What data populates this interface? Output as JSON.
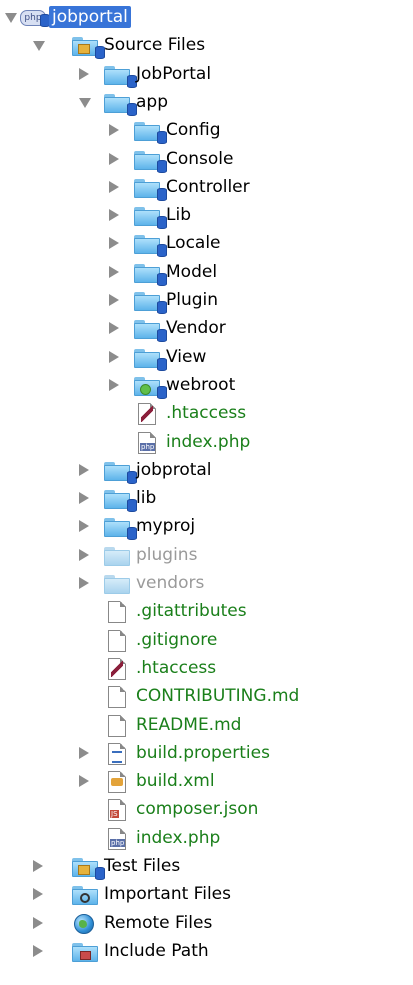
{
  "tree": [
    {
      "label": "jobportal",
      "icon": "php-project-icon",
      "twisty": "expanded",
      "level": 0,
      "style": "selected",
      "interactable": true
    },
    {
      "label": "Source Files",
      "icon": "source-folder-icon",
      "twisty": "expanded",
      "level": 1,
      "style": "normal"
    },
    {
      "label": "JobPortal",
      "icon": "folder-icon",
      "twisty": "collapsed",
      "level": 2,
      "style": "normal"
    },
    {
      "label": "app",
      "icon": "folder-icon",
      "twisty": "expanded",
      "level": 2,
      "style": "normal"
    },
    {
      "label": "Config",
      "icon": "folder-icon",
      "twisty": "collapsed",
      "level": 3,
      "style": "normal"
    },
    {
      "label": "Console",
      "icon": "folder-icon",
      "twisty": "collapsed",
      "level": 3,
      "style": "normal"
    },
    {
      "label": "Controller",
      "icon": "folder-icon",
      "twisty": "collapsed",
      "level": 3,
      "style": "normal"
    },
    {
      "label": "Lib",
      "icon": "folder-icon",
      "twisty": "collapsed",
      "level": 3,
      "style": "normal"
    },
    {
      "label": "Locale",
      "icon": "folder-icon",
      "twisty": "collapsed",
      "level": 3,
      "style": "normal"
    },
    {
      "label": "Model",
      "icon": "folder-icon",
      "twisty": "collapsed",
      "level": 3,
      "style": "normal"
    },
    {
      "label": "Plugin",
      "icon": "folder-icon",
      "twisty": "collapsed",
      "level": 3,
      "style": "normal"
    },
    {
      "label": "Vendor",
      "icon": "folder-icon",
      "twisty": "collapsed",
      "level": 3,
      "style": "normal"
    },
    {
      "label": "View",
      "icon": "folder-icon",
      "twisty": "collapsed",
      "level": 3,
      "style": "normal"
    },
    {
      "label": "webroot",
      "icon": "web-folder-icon",
      "twisty": "collapsed",
      "level": 3,
      "style": "normal"
    },
    {
      "label": ".htaccess",
      "icon": "htaccess-file-icon",
      "twisty": "none",
      "level": 3,
      "style": "green"
    },
    {
      "label": "index.php",
      "icon": "php-file-icon",
      "twisty": "none",
      "level": 3,
      "style": "green"
    },
    {
      "label": "jobprotal",
      "icon": "folder-icon",
      "twisty": "collapsed",
      "level": 2,
      "style": "normal"
    },
    {
      "label": "lib",
      "icon": "folder-icon",
      "twisty": "collapsed",
      "level": 2,
      "style": "normal"
    },
    {
      "label": "myproj",
      "icon": "folder-icon",
      "twisty": "collapsed",
      "level": 2,
      "style": "normal"
    },
    {
      "label": "plugins",
      "icon": "ignored-folder-icon",
      "twisty": "collapsed",
      "level": 2,
      "style": "gray"
    },
    {
      "label": "vendors",
      "icon": "ignored-folder-icon",
      "twisty": "collapsed",
      "level": 2,
      "style": "gray"
    },
    {
      "label": ".gitattributes",
      "icon": "text-file-icon",
      "twisty": "none",
      "level": 2,
      "style": "green"
    },
    {
      "label": ".gitignore",
      "icon": "text-file-icon",
      "twisty": "none",
      "level": 2,
      "style": "green"
    },
    {
      "label": ".htaccess",
      "icon": "htaccess-file-icon",
      "twisty": "none",
      "level": 2,
      "style": "green"
    },
    {
      "label": "CONTRIBUTING.md",
      "icon": "text-file-icon",
      "twisty": "none",
      "level": 2,
      "style": "green"
    },
    {
      "label": "README.md",
      "icon": "text-file-icon",
      "twisty": "none",
      "level": 2,
      "style": "green"
    },
    {
      "label": "build.properties",
      "icon": "properties-file-icon",
      "twisty": "collapsed",
      "level": 2,
      "style": "green"
    },
    {
      "label": "build.xml",
      "icon": "xml-file-icon",
      "twisty": "collapsed",
      "level": 2,
      "style": "green"
    },
    {
      "label": "composer.json",
      "icon": "json-file-icon",
      "twisty": "none",
      "level": 2,
      "style": "green"
    },
    {
      "label": "index.php",
      "icon": "php-file-icon",
      "twisty": "none",
      "level": 2,
      "style": "green"
    },
    {
      "label": "Test Files",
      "icon": "test-folder-icon",
      "twisty": "collapsed",
      "level": 1,
      "style": "normal"
    },
    {
      "label": "Important Files",
      "icon": "important-files-icon",
      "twisty": "collapsed",
      "level": 1,
      "style": "normal"
    },
    {
      "label": "Remote Files",
      "icon": "remote-files-globe-icon",
      "twisty": "collapsed",
      "level": 1,
      "style": "normal"
    },
    {
      "label": "Include Path",
      "icon": "include-path-icon",
      "twisty": "collapsed",
      "level": 1,
      "style": "normal"
    }
  ],
  "icon_tags": {
    "php": "php",
    "json": "JS"
  },
  "colors": {
    "selection": "#3874d8",
    "tracked_file_text": "#1a7f1a",
    "ignored_text": "#9a9a9a",
    "twisty": "#8c8c8c"
  }
}
